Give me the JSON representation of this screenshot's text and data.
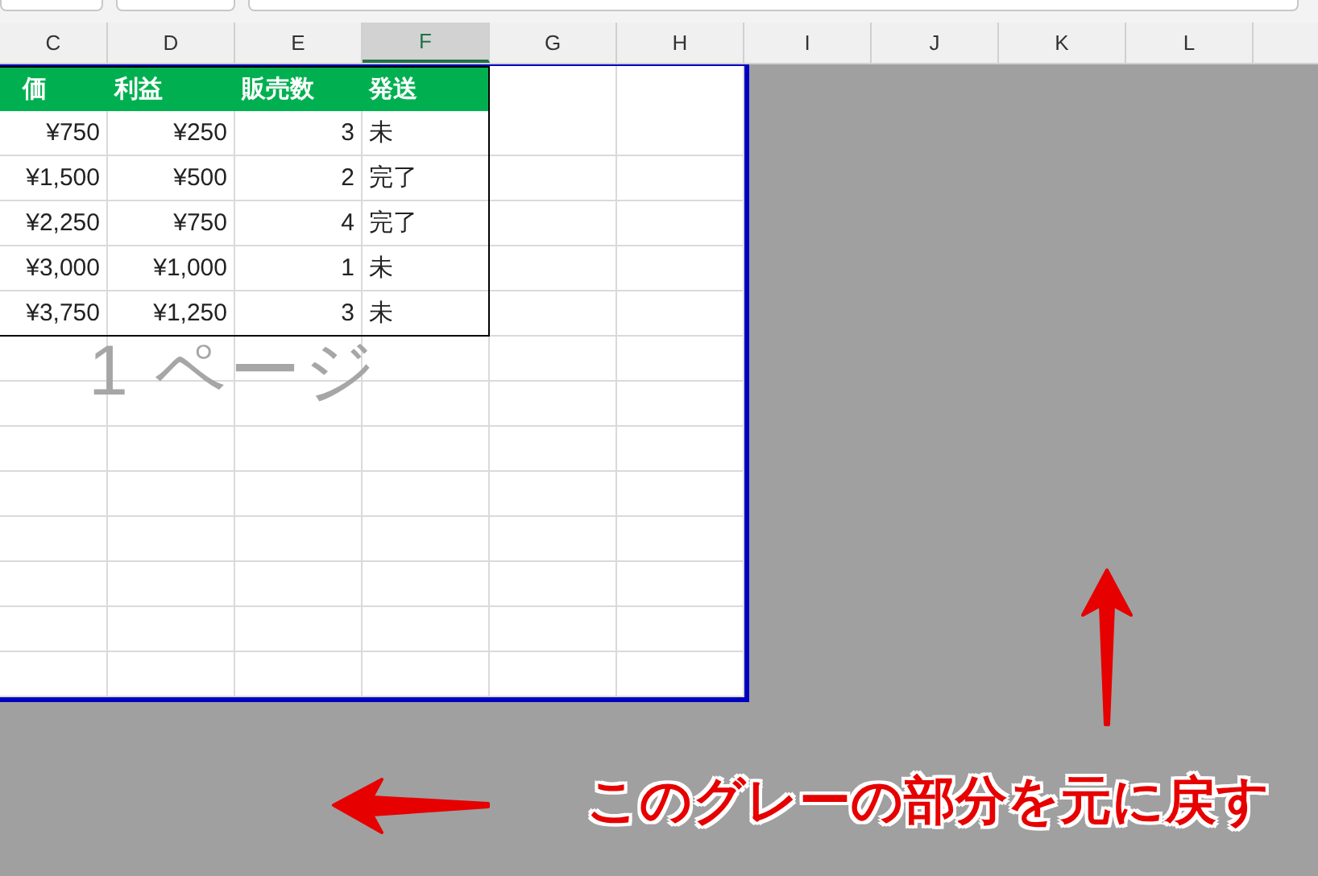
{
  "column_headers": [
    {
      "label": "C",
      "selected": false
    },
    {
      "label": "D",
      "selected": false
    },
    {
      "label": "E",
      "selected": false
    },
    {
      "label": "F",
      "selected": true
    },
    {
      "label": "G",
      "selected": false
    },
    {
      "label": "H",
      "selected": false
    },
    {
      "label": "I",
      "selected": false
    },
    {
      "label": "J",
      "selected": false
    },
    {
      "label": "K",
      "selected": false
    },
    {
      "label": "L",
      "selected": false
    }
  ],
  "table": {
    "columns": [
      "価",
      "利益",
      "販売数",
      "発送"
    ],
    "rows": [
      [
        "¥750",
        "¥250",
        "3",
        "未"
      ],
      [
        "¥1,500",
        "¥500",
        "2",
        "完了"
      ],
      [
        "¥2,250",
        "¥750",
        "4",
        "完了"
      ],
      [
        "¥3,000",
        "¥1,000",
        "1",
        "未"
      ],
      [
        "¥3,750",
        "¥1,250",
        "3",
        "未"
      ]
    ]
  },
  "page_label": "1 ページ",
  "caption": "このグレーの部分を元に戻す"
}
